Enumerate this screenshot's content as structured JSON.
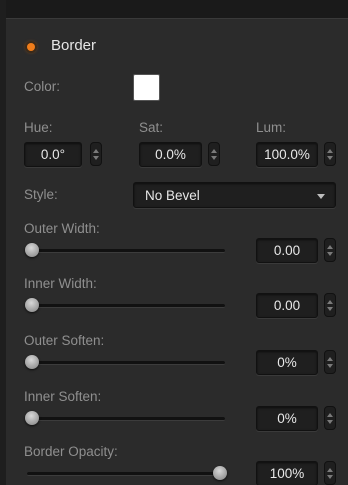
{
  "section": {
    "title": "Border",
    "enabled": true,
    "accent_color": "#f07c1a"
  },
  "color": {
    "label": "Color:",
    "value": "#ffffff"
  },
  "hue": {
    "label": "Hue:",
    "value": "0.0°"
  },
  "sat": {
    "label": "Sat:",
    "value": "0.0%"
  },
  "lum": {
    "label": "Lum:",
    "value": "100.0%"
  },
  "style": {
    "label": "Style:",
    "value": "No Bevel"
  },
  "sliders": [
    {
      "label": "Outer Width:",
      "value": "0.00",
      "position": 0.0
    },
    {
      "label": "Inner Width:",
      "value": "0.00",
      "position": 0.0
    },
    {
      "label": "Outer Soften:",
      "value": "0%",
      "position": 0.0
    },
    {
      "label": "Inner Soften:",
      "value": "0%",
      "position": 0.0
    },
    {
      "label": "Border Opacity:",
      "value": "100%",
      "position": 1.0
    }
  ]
}
